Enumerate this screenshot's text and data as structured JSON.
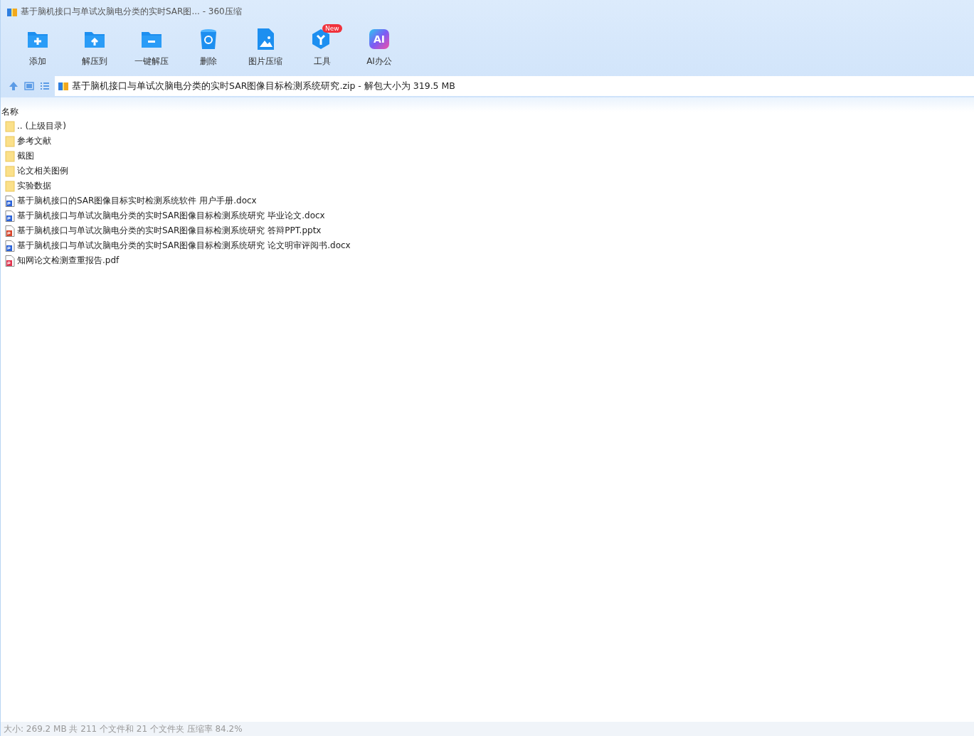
{
  "window": {
    "title": "基于脑机接口与单试次脑电分类的实时SAR图... - 360压缩"
  },
  "toolbar": [
    {
      "kind": "add",
      "label": "添加"
    },
    {
      "kind": "extract",
      "label": "解压到"
    },
    {
      "kind": "oneclick",
      "label": "一键解压"
    },
    {
      "kind": "delete",
      "label": "删除"
    },
    {
      "kind": "image",
      "label": "图片压缩"
    },
    {
      "kind": "tools",
      "label": "工具",
      "badge": "New"
    },
    {
      "kind": "ai",
      "label": "AI办公",
      "icon_text": "AI"
    }
  ],
  "address": {
    "path": "基于脑机接口与单试次脑电分类的实时SAR图像目标检测系统研究.zip - 解包大小为 319.5 MB"
  },
  "table": {
    "columns": [
      "名称"
    ],
    "rows": [
      {
        "kind": "folder",
        "name": ".. (上级目录)"
      },
      {
        "kind": "folder",
        "name": "参考文献"
      },
      {
        "kind": "folder",
        "name": "截图"
      },
      {
        "kind": "folder",
        "name": "论文相关图例"
      },
      {
        "kind": "folder",
        "name": "实验数据"
      },
      {
        "kind": "word",
        "name": "基于脑机接口的SAR图像目标实时检测系统软件 用户手册.docx"
      },
      {
        "kind": "word",
        "name": "基于脑机接口与单试次脑电分类的实时SAR图像目标检测系统研究 毕业论文.docx"
      },
      {
        "kind": "ppt",
        "name": "基于脑机接口与单试次脑电分类的实时SAR图像目标检测系统研究 答辩PPT.pptx"
      },
      {
        "kind": "word",
        "name": "基于脑机接口与单试次脑电分类的实时SAR图像目标检测系统研究 论文明审评阅书.docx"
      },
      {
        "kind": "pdf",
        "name": "知网论文检测查重报告.pdf"
      }
    ]
  },
  "status_bar": "大小: 269.2 MB 共 211 个文件和 21 个文件夹 压缩率 84.2%"
}
